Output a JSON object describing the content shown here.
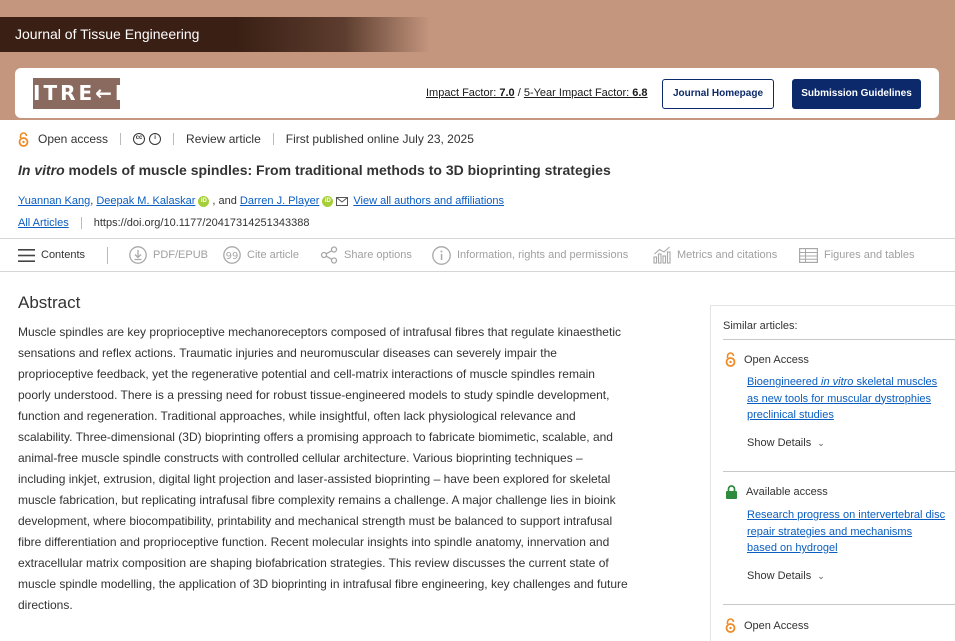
{
  "journal": {
    "name": "Journal of Tissue Engineering",
    "logo_text": "ITRE←N",
    "impact_factor_label": "Impact Factor: ",
    "impact_factor_value": "7.0",
    "separator": " / ",
    "five_year_label": "5-Year Impact Factor: ",
    "five_year_value": "6.8",
    "homepage_button": "Journal Homepage",
    "guidelines_button": "Submission Guidelines",
    "accent": "#0c2a6b",
    "banner_color": "#c4967e"
  },
  "meta": {
    "access": "Open access",
    "type": "Review article",
    "published": "First published online July 23, 2025"
  },
  "article": {
    "title_italic": "In vitro",
    "title_rest": " models of muscle spindles: From traditional methods to 3D bioprinting strategies",
    "author1": "Yuannan Kang",
    "author2": "Deepak M. Kalaskar",
    "and_text": ", and ",
    "author3": "Darren J. Player",
    "view_all": "View all authors and affiliations",
    "all_articles": "All Articles",
    "doi": "https://doi.org/10.1177/20417314251343388"
  },
  "toolbar": {
    "contents": "Contents",
    "pdf": "PDF/EPUB",
    "cite": "Cite article",
    "share": "Share options",
    "info": "Information, rights and permissions",
    "metrics": "Metrics and citations",
    "figures": "Figures and tables"
  },
  "abstract": {
    "heading": "Abstract",
    "text": "Muscle spindles are key proprioceptive mechanoreceptors composed of intrafusal fibres that regulate kinaesthetic sensations and reflex actions. Traumatic injuries and neuromuscular diseases can severely impair the proprioceptive feedback, yet the regenerative potential and cell-matrix interactions of muscle spindles remain poorly understood. There is a pressing need for robust tissue-engineered models to study spindle development, function and regeneration. Traditional approaches, while insightful, often lack physiological relevance and scalability. Three-dimensional (3D) bioprinting offers a promising approach to fabricate biomimetic, scalable, and animal-free muscle spindle constructs with controlled cellular architecture. Various bioprinting techniques – including inkjet, extrusion, digital light projection and laser-assisted bioprinting – have been explored for skeletal muscle fabrication, but replicating intrafusal fibre complexity remains a challenge. A major challenge lies in bioink development, where biocompatibility, printability and mechanical strength must be balanced to support intrafusal fibre differentiation and proprioceptive function. Recent molecular insights into spindle anatomy, innervation and extracellular matrix composition are shaping biofabrication strategies. This review discusses the current state of muscle spindle modelling, the application of 3D bioprinting in intrafusal fibre engineering, key challenges and future directions."
  },
  "similar": {
    "heading": "Similar articles:",
    "items": [
      {
        "access": "Open Access",
        "line1_pre": "Bioengineered ",
        "line1_italic": "in vitro",
        "line1_post": " skeletal muscles",
        "line2": "as new tools for muscular dystrophies",
        "line3": "preclinical studies",
        "details": "Show Details"
      },
      {
        "access": "Available access",
        "line1": "Research progress on intervertebral disc",
        "line2": "repair strategies and mechanisms",
        "line3": "based on hydrogel",
        "details": "Show Details"
      },
      {
        "access": "Open Access"
      }
    ],
    "open_color": "#f08a24",
    "available_color": "#2e8b3d"
  }
}
